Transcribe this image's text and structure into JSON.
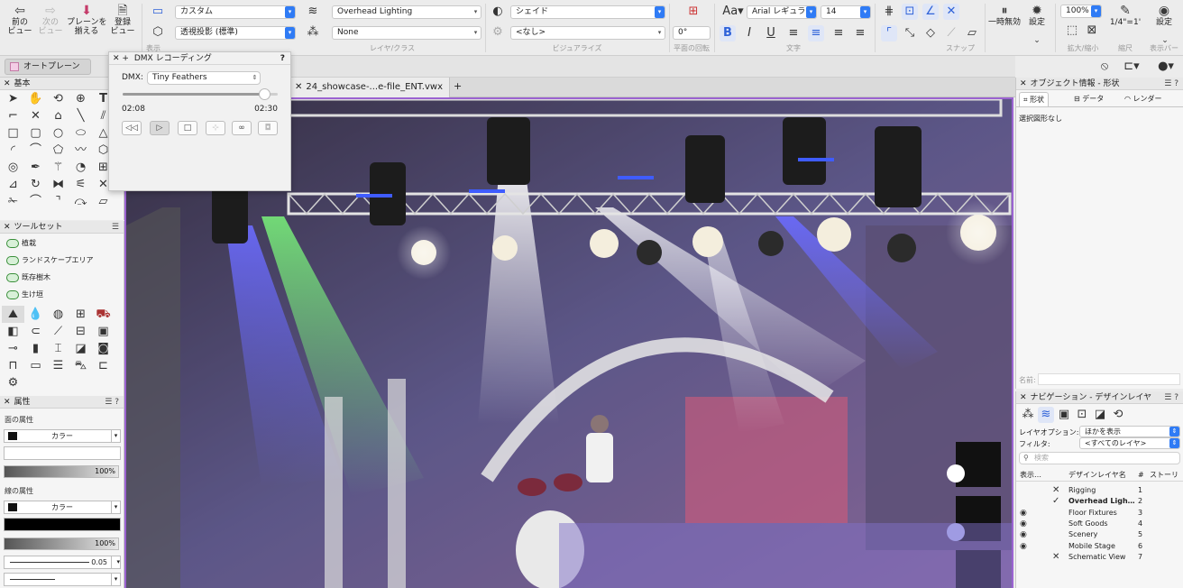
{
  "toolbar": {
    "prev_view_label": "前の\nビュー",
    "next_view_label": "次の\nビュー",
    "align_plane_label": "プレーンを\n揃える",
    "register_view_label": "登録\nビュー",
    "view_group_label": "表示",
    "class_select": "カスタム",
    "projection_select": "透視投影 (標準)",
    "layer_select": "Overhead Lighting",
    "class_layer_select": "None",
    "layer_class_group_label": "レイヤ/クラス",
    "render_select": "シェイド",
    "render_sub_select": "<なし>",
    "visualize_group_label": "ビジュアライズ",
    "rotation_value": "0°",
    "plane_rotation_label": "平面の回転",
    "font_select": "Arial レギュラー",
    "font_size": "14",
    "text_group_label": "文字",
    "snap_group_label": "スナップ",
    "pause_label": "一時無効",
    "settings_label": "設定",
    "zoom_value": "100%",
    "zoom_group_label": "拡大/縮小",
    "scale_value": "1/4\"=1'",
    "scale_group_label": "縮尺",
    "display_bar_label": "表示バー",
    "display_settings_label": "設定"
  },
  "left": {
    "auto_plane_label": "オートプレーン",
    "basic_title": "基本",
    "toolset_title": "ツールセット",
    "toolset_items": [
      "植栽",
      "ランドスケープエリア",
      "既存樹木",
      "生け垣"
    ],
    "attributes_title": "属性",
    "fill_label": "面の属性",
    "fill_color": "カラー",
    "fill_opacity": "100%",
    "line_label": "線の属性",
    "line_color": "カラー",
    "line_opacity": "100%",
    "line_weight": "0.05"
  },
  "dmx": {
    "title": "DMX レコーディング",
    "help": "?",
    "dmx_label": "DMX:",
    "dmx_select": "Tiny Feathers",
    "time_current": "02:08",
    "time_total": "02:30",
    "progress": 0.92
  },
  "document": {
    "tab_title": "24_showcase-...e-file_ENT.vwx",
    "add_tab": "+"
  },
  "oip": {
    "title": "オブジェクト情報 - 形状",
    "tabs": [
      "形状",
      "データ",
      "レンダー"
    ],
    "no_selection": "選択図形なし",
    "name_label": "名前:"
  },
  "nav": {
    "title": "ナビゲーション - デザインレイヤ",
    "layer_options_label": "レイヤオプション:",
    "layer_options_value": "ほかを表示",
    "filter_label": "フィルタ:",
    "filter_value": "<すべてのレイヤ>",
    "search_placeholder": "検索",
    "col_visibility": "表示…",
    "col_name": "デザインレイヤ名",
    "col_number": "#",
    "col_story": "ストーリ",
    "layers": [
      {
        "name": "Rigging",
        "number": "1"
      },
      {
        "name": "Overhead Ligh…",
        "number": "2"
      },
      {
        "name": "Floor Fixtures",
        "number": "3"
      },
      {
        "name": "Soft Goods",
        "number": "4"
      },
      {
        "name": "Scenery",
        "number": "5"
      },
      {
        "name": "Mobile Stage",
        "number": "6"
      },
      {
        "name": "Schematic View",
        "number": "7"
      }
    ]
  },
  "colors": {
    "accent": "#2f7bf5",
    "active_doc_border": "#9b63d1"
  }
}
